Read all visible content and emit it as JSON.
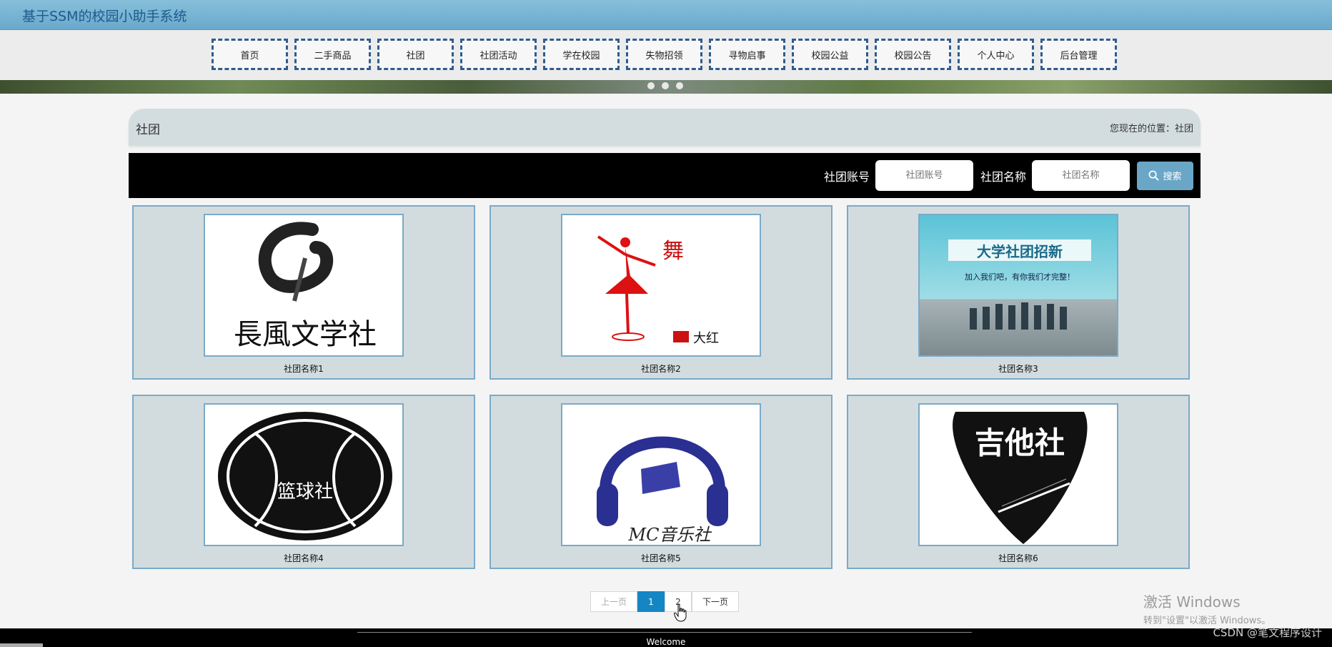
{
  "app": {
    "title": "基于SSM的校园小助手系统"
  },
  "nav": {
    "items": [
      "首页",
      "二手商品",
      "社团",
      "社团活动",
      "学在校园",
      "失物招领",
      "寻物启事",
      "校园公益",
      "校园公告",
      "个人中心",
      "后台管理"
    ]
  },
  "breadcrumb": {
    "title": "社团",
    "location": "您现在的位置：社团"
  },
  "search": {
    "account_label": "社团账号",
    "account_placeholder": "社团账号",
    "name_label": "社团名称",
    "name_placeholder": "社团名称",
    "button_label": "搜索"
  },
  "clubs": [
    {
      "name": "社团名称1",
      "image_text": "長風文学社"
    },
    {
      "name": "社团名称2",
      "image_text": "大红"
    },
    {
      "name": "社团名称3",
      "image_text": "大学社团招新",
      "image_subtext": "加入我们吧，有你我们才完整！"
    },
    {
      "name": "社团名称4",
      "image_text": "篮球社"
    },
    {
      "name": "社团名称5",
      "image_text": "MC音乐社"
    },
    {
      "name": "社团名称6",
      "image_text": "吉他社"
    }
  ],
  "pagination": {
    "prev": "上一页",
    "pages": [
      "1",
      "2"
    ],
    "current": "1",
    "next": "下一页"
  },
  "footer": {
    "welcome": "Welcome"
  },
  "watermark": {
    "line1": "激活 Windows",
    "line2": "转到\"设置\"以激活 Windows。"
  },
  "credit": "CSDN @笔文程序设计",
  "colors": {
    "accent": "#1586c4",
    "nav_border": "#2f5c8f",
    "card_border": "#7aaac8",
    "search_button": "#6aa6c6"
  }
}
